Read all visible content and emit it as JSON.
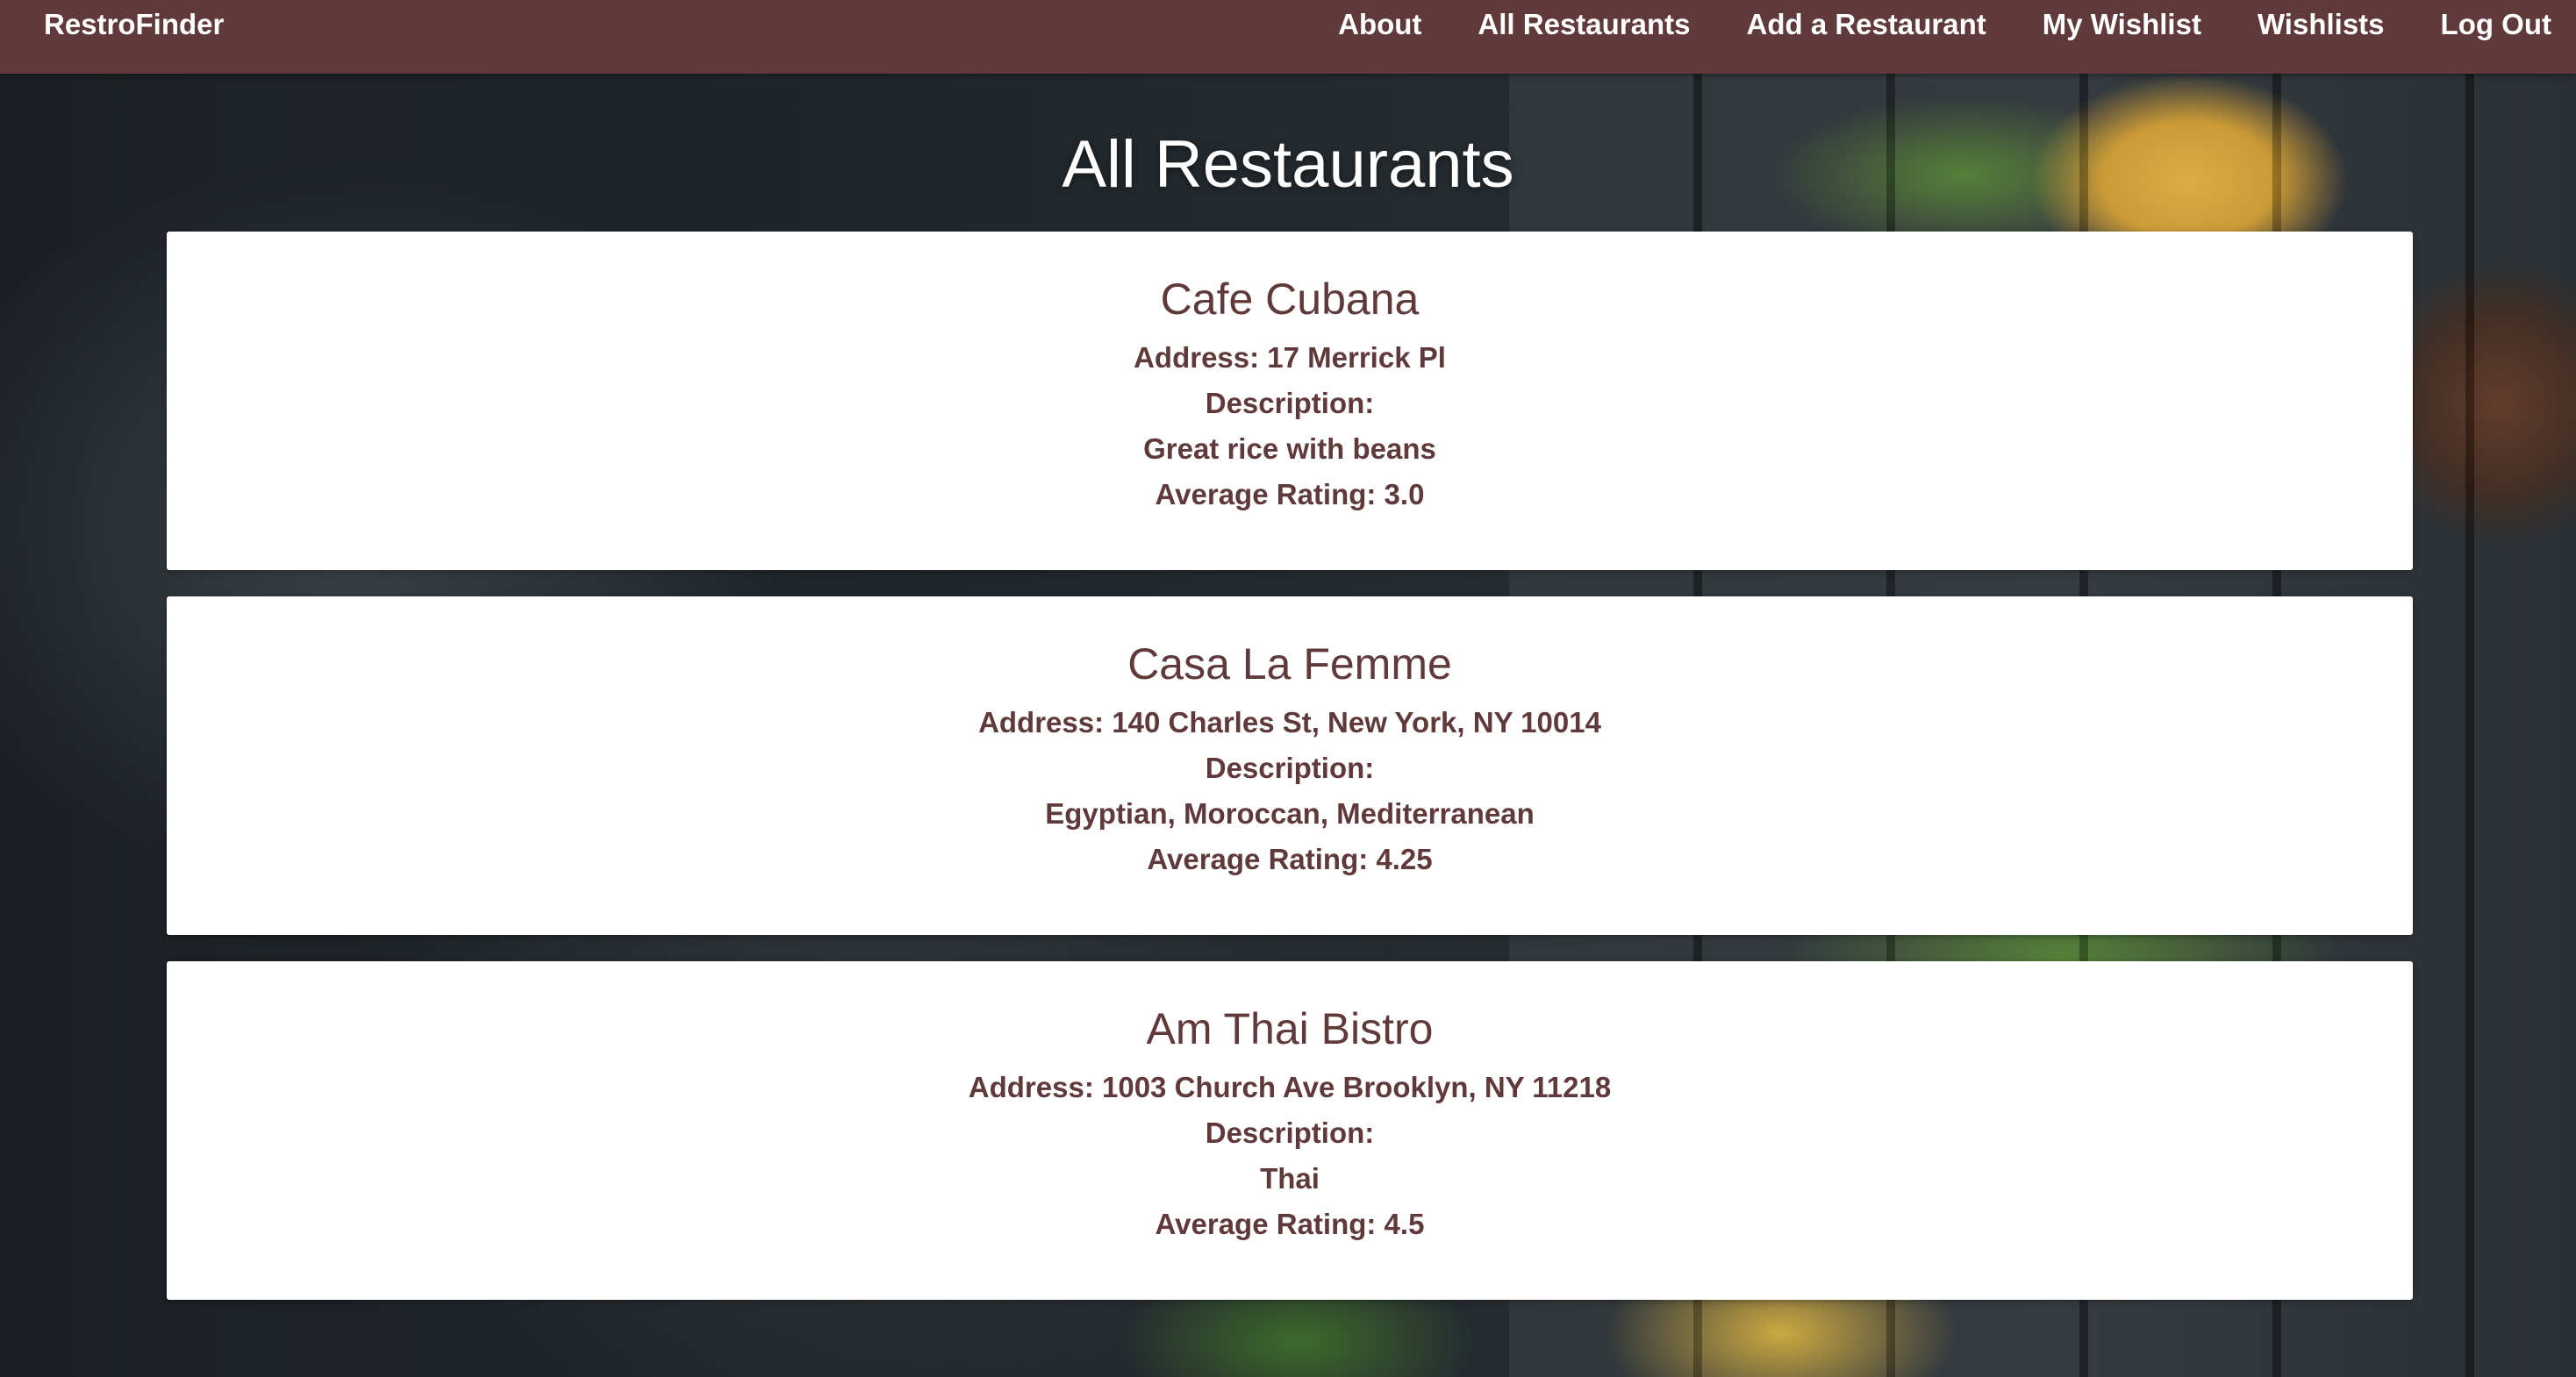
{
  "nav": {
    "brand": "RestroFinder",
    "links": [
      "About",
      "All Restaurants",
      "Add a Restaurant",
      "My Wishlist",
      "Wishlists",
      "Log Out"
    ]
  },
  "page": {
    "title": "All Restaurants"
  },
  "restaurants": [
    {
      "name": "Cafe Cubana",
      "address": "Address: 17 Merrick Pl",
      "description_label": "Description:",
      "description": "Great rice with beans",
      "rating": "Average Rating: 3.0"
    },
    {
      "name": "Casa La Femme",
      "address": "Address: 140 Charles St, New York, NY 10014",
      "description_label": "Description:",
      "description": "Egyptian, Moroccan, Mediterranean",
      "rating": "Average Rating: 4.25"
    },
    {
      "name": "Am Thai Bistro",
      "address": "Address: 1003 Church Ave Brooklyn, NY 11218",
      "description_label": "Description:",
      "description": "Thai",
      "rating": "Average Rating: 4.5"
    }
  ],
  "colors": {
    "navbar": "#603a3a",
    "card_text": "#603a3a",
    "card_bg": "#ffffff",
    "title": "#ffffff"
  }
}
